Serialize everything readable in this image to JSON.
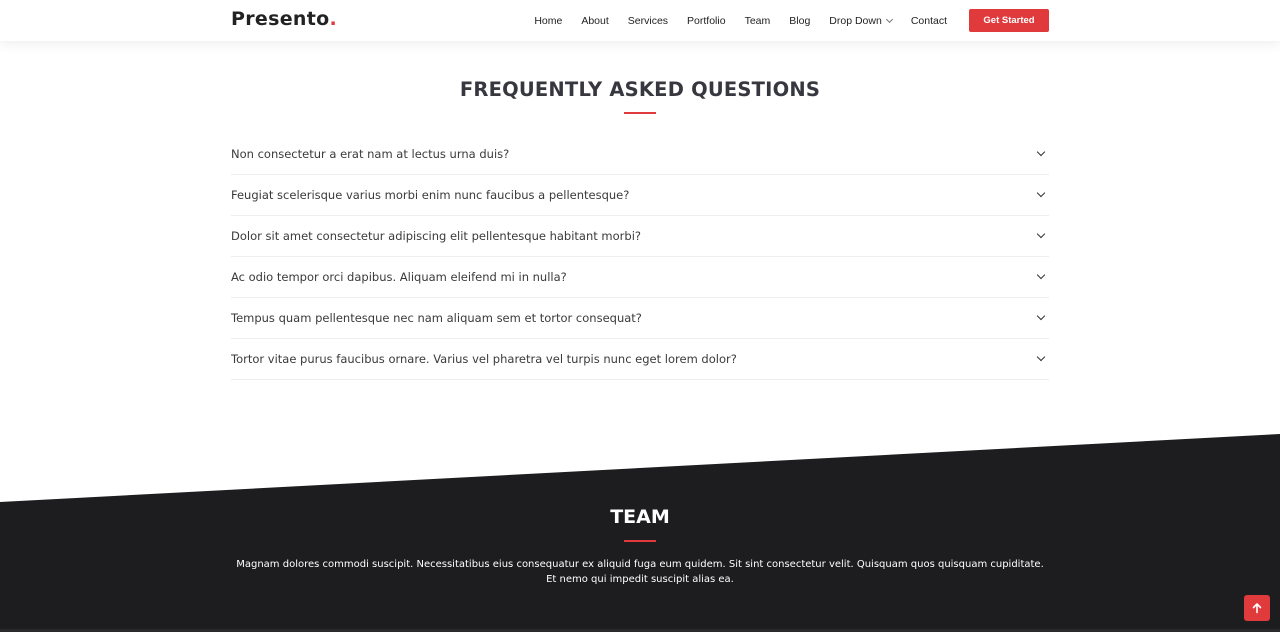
{
  "brand": {
    "name": "Presento",
    "dot": ".",
    "accent_color": "#e03a3c"
  },
  "nav": {
    "items": [
      "Home",
      "About",
      "Services",
      "Portfolio",
      "Team",
      "Blog",
      "Drop Down",
      "Contact"
    ],
    "cta_label": "Get Started"
  },
  "faq": {
    "title": "FREQUENTLY ASKED QUESTIONS",
    "questions": [
      "Non consectetur a erat nam at lectus urna duis?",
      "Feugiat scelerisque varius morbi enim nunc faucibus a pellentesque?",
      "Dolor sit amet consectetur adipiscing elit pellentesque habitant morbi?",
      "Ac odio tempor orci dapibus. Aliquam eleifend mi in nulla?",
      "Tempus quam pellentesque nec nam aliquam sem et tortor consequat?",
      "Tortor vitae purus faucibus ornare. Varius vel pharetra vel turpis nunc eget lorem dolor?"
    ]
  },
  "team": {
    "title": "TEAM",
    "description": "Magnam dolores commodi suscipit. Necessitatibus eius consequatur ex aliquid fuga eum quidem. Sit sint consectetur velit. Quisquam quos quisquam cupiditate. Et nemo qui impedit suscipit alias ea.",
    "background_color": "#1d1d1f"
  },
  "icons": {
    "back_to_top": "arrow-up-icon",
    "faq_toggle": "chevron-down-icon",
    "dropdown": "chevron-down-icon"
  }
}
